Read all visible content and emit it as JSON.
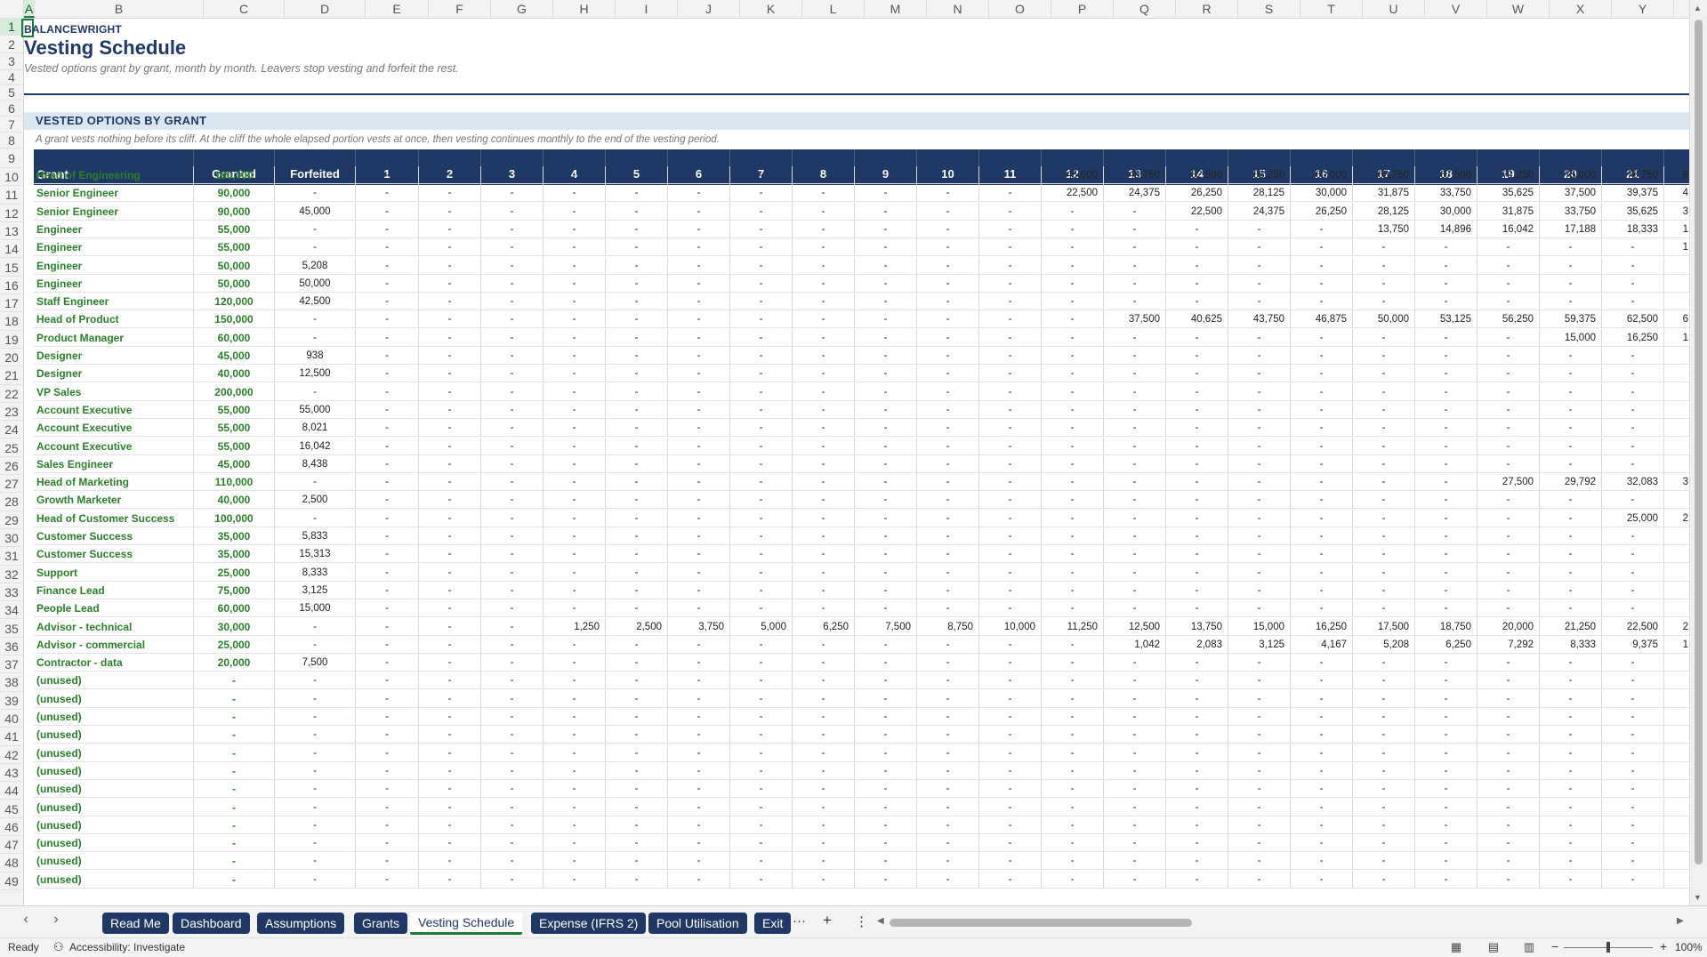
{
  "brand": "BALANCEWRIGHT",
  "title": "Vesting Schedule",
  "subtitle": "Vested options grant by grant, month by month. Leavers stop vesting and forfeit the rest.",
  "section": {
    "title": "VESTED OPTIONS BY GRANT",
    "note": "A grant vests nothing before its cliff. At the cliff the whole elapsed portion vests at once, then vesting continues monthly to the end of the vesting period."
  },
  "column_letters": [
    "A",
    "B",
    "C",
    "D",
    "E",
    "F",
    "G",
    "H",
    "I",
    "J",
    "K",
    "L",
    "M",
    "N",
    "O",
    "P",
    "Q",
    "R",
    "S",
    "T",
    "U",
    "V",
    "W",
    "X",
    "Y"
  ],
  "row_numbers": [
    1,
    2,
    3,
    4,
    5,
    6,
    7,
    8,
    9,
    10,
    11,
    12,
    13,
    14,
    15,
    16,
    17,
    18,
    19,
    20,
    21,
    22,
    23,
    24,
    25,
    26,
    27,
    28,
    29,
    30,
    31,
    32,
    33,
    34,
    35,
    36,
    37,
    38,
    39,
    40,
    41,
    42,
    43,
    44,
    45,
    46,
    47,
    48,
    49
  ],
  "table": {
    "headers": [
      "Grant",
      "Granted",
      "Forfeited",
      "1",
      "2",
      "3",
      "4",
      "5",
      "6",
      "7",
      "8",
      "9",
      "10",
      "11",
      "12",
      "13",
      "14",
      "15",
      "16",
      "17",
      "18",
      "19",
      "20",
      "21"
    ],
    "rows": [
      [
        "Head of Engineering",
        "180,000",
        "-",
        "-",
        "-",
        "-",
        "-",
        "-",
        "-",
        "-",
        "-",
        "-",
        "-",
        "-",
        "45,000",
        "48,750",
        "52,500",
        "56,250",
        "60,000",
        "63,750",
        "67,500",
        "71,250",
        "75,000",
        "78,750"
      ],
      [
        "Senior Engineer",
        "90,000",
        "-",
        "-",
        "-",
        "-",
        "-",
        "-",
        "-",
        "-",
        "-",
        "-",
        "-",
        "-",
        "22,500",
        "24,375",
        "26,250",
        "28,125",
        "30,000",
        "31,875",
        "33,750",
        "35,625",
        "37,500",
        "39,375"
      ],
      [
        "Senior Engineer",
        "90,000",
        "45,000",
        "-",
        "-",
        "-",
        "-",
        "-",
        "-",
        "-",
        "-",
        "-",
        "-",
        "-",
        "-",
        "-",
        "22,500",
        "24,375",
        "26,250",
        "28,125",
        "30,000",
        "31,875",
        "33,750",
        "35,625"
      ],
      [
        "Engineer",
        "55,000",
        "-",
        "-",
        "-",
        "-",
        "-",
        "-",
        "-",
        "-",
        "-",
        "-",
        "-",
        "-",
        "-",
        "-",
        "-",
        "-",
        "-",
        "13,750",
        "14,896",
        "16,042",
        "17,188",
        "18,333"
      ],
      [
        "Engineer",
        "55,000",
        "-",
        "-",
        "-",
        "-",
        "-",
        "-",
        "-",
        "-",
        "-",
        "-",
        "-",
        "-",
        "-",
        "-",
        "-",
        "-",
        "-",
        "-",
        "-",
        "-",
        "-",
        "-"
      ],
      [
        "Engineer",
        "50,000",
        "5,208",
        "-",
        "-",
        "-",
        "-",
        "-",
        "-",
        "-",
        "-",
        "-",
        "-",
        "-",
        "-",
        "-",
        "-",
        "-",
        "-",
        "-",
        "-",
        "-",
        "-",
        "-"
      ],
      [
        "Engineer",
        "50,000",
        "50,000",
        "-",
        "-",
        "-",
        "-",
        "-",
        "-",
        "-",
        "-",
        "-",
        "-",
        "-",
        "-",
        "-",
        "-",
        "-",
        "-",
        "-",
        "-",
        "-",
        "-",
        "-"
      ],
      [
        "Staff Engineer",
        "120,000",
        "42,500",
        "-",
        "-",
        "-",
        "-",
        "-",
        "-",
        "-",
        "-",
        "-",
        "-",
        "-",
        "-",
        "-",
        "-",
        "-",
        "-",
        "-",
        "-",
        "-",
        "-",
        "-"
      ],
      [
        "Head of Product",
        "150,000",
        "-",
        "-",
        "-",
        "-",
        "-",
        "-",
        "-",
        "-",
        "-",
        "-",
        "-",
        "-",
        "-",
        "37,500",
        "40,625",
        "43,750",
        "46,875",
        "50,000",
        "53,125",
        "56,250",
        "59,375",
        "62,500"
      ],
      [
        "Product Manager",
        "60,000",
        "-",
        "-",
        "-",
        "-",
        "-",
        "-",
        "-",
        "-",
        "-",
        "-",
        "-",
        "-",
        "-",
        "-",
        "-",
        "-",
        "-",
        "-",
        "-",
        "-",
        "15,000",
        "16,250"
      ],
      [
        "Designer",
        "45,000",
        "938",
        "-",
        "-",
        "-",
        "-",
        "-",
        "-",
        "-",
        "-",
        "-",
        "-",
        "-",
        "-",
        "-",
        "-",
        "-",
        "-",
        "-",
        "-",
        "-",
        "-",
        "-"
      ],
      [
        "Designer",
        "40,000",
        "12,500",
        "-",
        "-",
        "-",
        "-",
        "-",
        "-",
        "-",
        "-",
        "-",
        "-",
        "-",
        "-",
        "-",
        "-",
        "-",
        "-",
        "-",
        "-",
        "-",
        "-",
        "-"
      ],
      [
        "VP Sales",
        "200,000",
        "-",
        "-",
        "-",
        "-",
        "-",
        "-",
        "-",
        "-",
        "-",
        "-",
        "-",
        "-",
        "-",
        "-",
        "-",
        "-",
        "-",
        "-",
        "-",
        "-",
        "-",
        "-"
      ],
      [
        "Account Executive",
        "55,000",
        "55,000",
        "-",
        "-",
        "-",
        "-",
        "-",
        "-",
        "-",
        "-",
        "-",
        "-",
        "-",
        "-",
        "-",
        "-",
        "-",
        "-",
        "-",
        "-",
        "-",
        "-",
        "-"
      ],
      [
        "Account Executive",
        "55,000",
        "8,021",
        "-",
        "-",
        "-",
        "-",
        "-",
        "-",
        "-",
        "-",
        "-",
        "-",
        "-",
        "-",
        "-",
        "-",
        "-",
        "-",
        "-",
        "-",
        "-",
        "-",
        "-"
      ],
      [
        "Account Executive",
        "55,000",
        "16,042",
        "-",
        "-",
        "-",
        "-",
        "-",
        "-",
        "-",
        "-",
        "-",
        "-",
        "-",
        "-",
        "-",
        "-",
        "-",
        "-",
        "-",
        "-",
        "-",
        "-",
        "-"
      ],
      [
        "Sales Engineer",
        "45,000",
        "8,438",
        "-",
        "-",
        "-",
        "-",
        "-",
        "-",
        "-",
        "-",
        "-",
        "-",
        "-",
        "-",
        "-",
        "-",
        "-",
        "-",
        "-",
        "-",
        "-",
        "-",
        "-"
      ],
      [
        "Head of Marketing",
        "110,000",
        "-",
        "-",
        "-",
        "-",
        "-",
        "-",
        "-",
        "-",
        "-",
        "-",
        "-",
        "-",
        "-",
        "-",
        "-",
        "-",
        "-",
        "-",
        "-",
        "27,500",
        "29,792",
        "32,083"
      ],
      [
        "Growth Marketer",
        "40,000",
        "2,500",
        "-",
        "-",
        "-",
        "-",
        "-",
        "-",
        "-",
        "-",
        "-",
        "-",
        "-",
        "-",
        "-",
        "-",
        "-",
        "-",
        "-",
        "-",
        "-",
        "-",
        "-"
      ],
      [
        "Head of Customer Success",
        "100,000",
        "-",
        "-",
        "-",
        "-",
        "-",
        "-",
        "-",
        "-",
        "-",
        "-",
        "-",
        "-",
        "-",
        "-",
        "-",
        "-",
        "-",
        "-",
        "-",
        "-",
        "-",
        "25,000"
      ],
      [
        "Customer Success",
        "35,000",
        "5,833",
        "-",
        "-",
        "-",
        "-",
        "-",
        "-",
        "-",
        "-",
        "-",
        "-",
        "-",
        "-",
        "-",
        "-",
        "-",
        "-",
        "-",
        "-",
        "-",
        "-",
        "-"
      ],
      [
        "Customer Success",
        "35,000",
        "15,313",
        "-",
        "-",
        "-",
        "-",
        "-",
        "-",
        "-",
        "-",
        "-",
        "-",
        "-",
        "-",
        "-",
        "-",
        "-",
        "-",
        "-",
        "-",
        "-",
        "-",
        "-"
      ],
      [
        "Support",
        "25,000",
        "8,333",
        "-",
        "-",
        "-",
        "-",
        "-",
        "-",
        "-",
        "-",
        "-",
        "-",
        "-",
        "-",
        "-",
        "-",
        "-",
        "-",
        "-",
        "-",
        "-",
        "-",
        "-"
      ],
      [
        "Finance Lead",
        "75,000",
        "3,125",
        "-",
        "-",
        "-",
        "-",
        "-",
        "-",
        "-",
        "-",
        "-",
        "-",
        "-",
        "-",
        "-",
        "-",
        "-",
        "-",
        "-",
        "-",
        "-",
        "-",
        "-"
      ],
      [
        "People Lead",
        "60,000",
        "15,000",
        "-",
        "-",
        "-",
        "-",
        "-",
        "-",
        "-",
        "-",
        "-",
        "-",
        "-",
        "-",
        "-",
        "-",
        "-",
        "-",
        "-",
        "-",
        "-",
        "-",
        "-"
      ],
      [
        "Advisor - technical",
        "30,000",
        "-",
        "-",
        "-",
        "-",
        "1,250",
        "2,500",
        "3,750",
        "5,000",
        "6,250",
        "7,500",
        "8,750",
        "10,000",
        "11,250",
        "12,500",
        "13,750",
        "15,000",
        "16,250",
        "17,500",
        "18,750",
        "20,000",
        "21,250",
        "22,500"
      ],
      [
        "Advisor - commercial",
        "25,000",
        "-",
        "-",
        "-",
        "-",
        "-",
        "-",
        "-",
        "-",
        "-",
        "-",
        "-",
        "-",
        "-",
        "1,042",
        "2,083",
        "3,125",
        "4,167",
        "5,208",
        "6,250",
        "7,292",
        "8,333",
        "9,375"
      ],
      [
        "Contractor - data",
        "20,000",
        "7,500",
        "-",
        "-",
        "-",
        "-",
        "-",
        "-",
        "-",
        "-",
        "-",
        "-",
        "-",
        "-",
        "-",
        "-",
        "-",
        "-",
        "-",
        "-",
        "-",
        "-",
        "-"
      ],
      [
        "(unused)",
        "-",
        "-",
        "-",
        "-",
        "-",
        "-",
        "-",
        "-",
        "-",
        "-",
        "-",
        "-",
        "-",
        "-",
        "-",
        "-",
        "-",
        "-",
        "-",
        "-",
        "-",
        "-",
        "-"
      ],
      [
        "(unused)",
        "-",
        "-",
        "-",
        "-",
        "-",
        "-",
        "-",
        "-",
        "-",
        "-",
        "-",
        "-",
        "-",
        "-",
        "-",
        "-",
        "-",
        "-",
        "-",
        "-",
        "-",
        "-",
        "-"
      ],
      [
        "(unused)",
        "-",
        "-",
        "-",
        "-",
        "-",
        "-",
        "-",
        "-",
        "-",
        "-",
        "-",
        "-",
        "-",
        "-",
        "-",
        "-",
        "-",
        "-",
        "-",
        "-",
        "-",
        "-",
        "-"
      ],
      [
        "(unused)",
        "-",
        "-",
        "-",
        "-",
        "-",
        "-",
        "-",
        "-",
        "-",
        "-",
        "-",
        "-",
        "-",
        "-",
        "-",
        "-",
        "-",
        "-",
        "-",
        "-",
        "-",
        "-",
        "-"
      ],
      [
        "(unused)",
        "-",
        "-",
        "-",
        "-",
        "-",
        "-",
        "-",
        "-",
        "-",
        "-",
        "-",
        "-",
        "-",
        "-",
        "-",
        "-",
        "-",
        "-",
        "-",
        "-",
        "-",
        "-",
        "-"
      ],
      [
        "(unused)",
        "-",
        "-",
        "-",
        "-",
        "-",
        "-",
        "-",
        "-",
        "-",
        "-",
        "-",
        "-",
        "-",
        "-",
        "-",
        "-",
        "-",
        "-",
        "-",
        "-",
        "-",
        "-",
        "-"
      ],
      [
        "(unused)",
        "-",
        "-",
        "-",
        "-",
        "-",
        "-",
        "-",
        "-",
        "-",
        "-",
        "-",
        "-",
        "-",
        "-",
        "-",
        "-",
        "-",
        "-",
        "-",
        "-",
        "-",
        "-",
        "-"
      ],
      [
        "(unused)",
        "-",
        "-",
        "-",
        "-",
        "-",
        "-",
        "-",
        "-",
        "-",
        "-",
        "-",
        "-",
        "-",
        "-",
        "-",
        "-",
        "-",
        "-",
        "-",
        "-",
        "-",
        "-",
        "-"
      ],
      [
        "(unused)",
        "-",
        "-",
        "-",
        "-",
        "-",
        "-",
        "-",
        "-",
        "-",
        "-",
        "-",
        "-",
        "-",
        "-",
        "-",
        "-",
        "-",
        "-",
        "-",
        "-",
        "-",
        "-",
        "-"
      ],
      [
        "(unused)",
        "-",
        "-",
        "-",
        "-",
        "-",
        "-",
        "-",
        "-",
        "-",
        "-",
        "-",
        "-",
        "-",
        "-",
        "-",
        "-",
        "-",
        "-",
        "-",
        "-",
        "-",
        "-",
        "-"
      ],
      [
        "(unused)",
        "-",
        "-",
        "-",
        "-",
        "-",
        "-",
        "-",
        "-",
        "-",
        "-",
        "-",
        "-",
        "-",
        "-",
        "-",
        "-",
        "-",
        "-",
        "-",
        "-",
        "-",
        "-",
        "-"
      ],
      [
        "(unused)",
        "-",
        "-",
        "-",
        "-",
        "-",
        "-",
        "-",
        "-",
        "-",
        "-",
        "-",
        "-",
        "-",
        "-",
        "-",
        "-",
        "-",
        "-",
        "-",
        "-",
        "-",
        "-",
        "-"
      ]
    ],
    "overflow_col": [
      "8",
      "4",
      "3",
      "1",
      "1",
      "",
      "",
      "",
      "6",
      "1",
      "",
      "",
      "",
      "",
      "",
      "",
      "",
      "3",
      "",
      "2",
      "",
      "",
      "",
      "",
      "",
      "2",
      "1",
      "",
      "",
      "",
      "",
      "",
      "",
      "",
      "",
      "",
      "",
      "",
      ""
    ]
  },
  "tabs": [
    "Read Me",
    "Dashboard",
    "Assumptions",
    "Grants",
    "Vesting Schedule",
    "Expense (IFRS 2)",
    "Pool Utilisation",
    "Exit"
  ],
  "active_tab": "Vesting Schedule",
  "tab_controls": {
    "more": "···",
    "add": "+",
    "menu": "⋮"
  },
  "status": {
    "ready": "Ready",
    "accessibility": "Accessibility: Investigate",
    "zoom": "100%"
  },
  "icons": [
    "nav-prev-icon",
    "nav-next-icon",
    "accessibility-icon",
    "normal-view-icon",
    "page-layout-icon",
    "page-break-icon",
    "zoom-out-icon",
    "zoom-in-icon"
  ],
  "colors": {
    "header_navy": "#1f3864",
    "name_green": "#2d7f2d",
    "section_band": "#dce6f1",
    "selection_green": "#1e7a3c"
  }
}
